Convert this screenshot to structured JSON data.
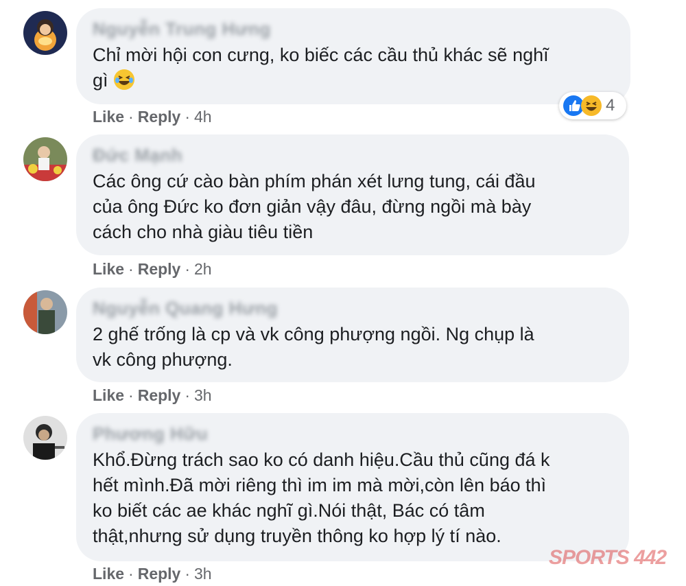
{
  "comments": [
    {
      "author": "Nguyễn Trung Hưng",
      "text": "Chỉ mời hội con cưng, ko biếc các cầu thủ khác sẽ nghĩ\ngì",
      "emoji": "laughing-emoji",
      "like": "Like",
      "reply": "Reply",
      "time": "4h",
      "reaction_count": "4",
      "reactions": [
        "like",
        "haha"
      ]
    },
    {
      "author": "Đức Mạnh",
      "text": "Các ông cứ cào bàn phím phán xét lưng tung, cái đầu\ncủa ông Đức ko đơn giản vậy đâu, đừng ngồi mà bày\ncách cho nhà giàu tiêu tiền",
      "like": "Like",
      "reply": "Reply",
      "time": "2h"
    },
    {
      "author": "Nguyễn Quang Hưng",
      "text": "2 ghế trống là cp và vk công phượng ngồi. Ng chụp là\nvk công phượng.",
      "like": "Like",
      "reply": "Reply",
      "time": "3h"
    },
    {
      "author": "Phương Hữu",
      "text": "Khổ.Đừng trách sao ko có danh hiệu.Cầu thủ cũng đá k\nhết mình.Đã mời riêng thì im im mà mời,còn lên báo thì\nko biết các ae khác nghĩ gì.Nói thật, Bác có tâm\nthật,nhưng sử dụng truyền thông ko hợp lý tí nào.",
      "like": "Like",
      "reply": "Reply",
      "time": "3h"
    }
  ],
  "separator": "·",
  "watermark": "SPORTS 442",
  "colors": {
    "bubble": "#f0f2f5",
    "like_blue": "#1877f2",
    "haha_yellow": "#f7b928",
    "watermark": "#e05050"
  }
}
